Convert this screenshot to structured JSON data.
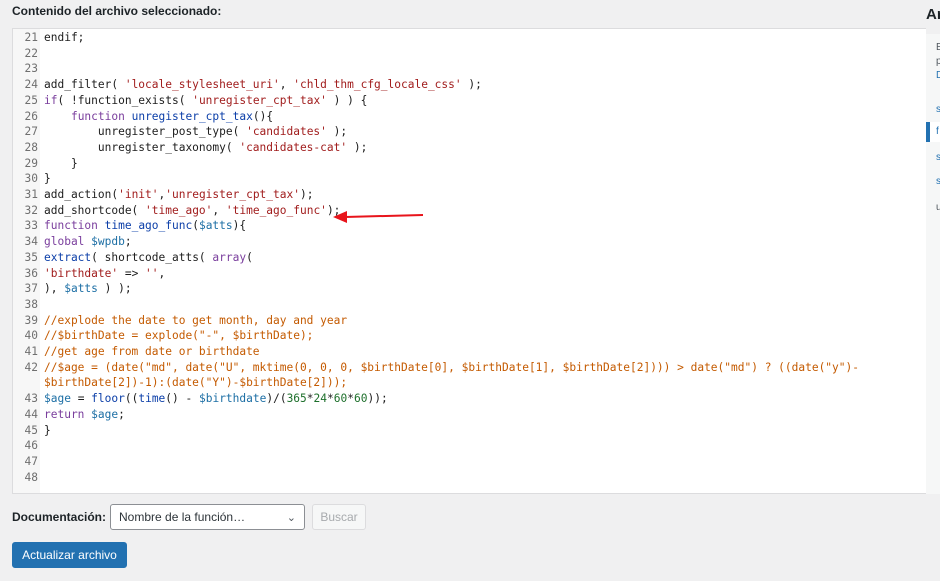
{
  "heading": "Contenido del archivo seleccionado:",
  "side_title": "Ar",
  "side_stubs": [
    "E",
    "p",
    "D",
    "s",
    "f",
    "s",
    "s",
    "u"
  ],
  "editor_lines": [
    {
      "n": "21",
      "segs": [
        [
          "endif;",
          ""
        ]
      ]
    },
    {
      "n": "22",
      "segs": []
    },
    {
      "n": "23",
      "segs": []
    },
    {
      "n": "24",
      "segs": [
        [
          "add_filter( ",
          ""
        ],
        [
          "'locale_stylesheet_uri'",
          "str"
        ],
        [
          ", ",
          ""
        ],
        [
          "'chld_thm_cfg_locale_css'",
          "str"
        ],
        [
          " );",
          ""
        ]
      ]
    },
    {
      "n": "25",
      "segs": [
        [
          "if",
          "kw"
        ],
        [
          "( !function_exists( ",
          ""
        ],
        [
          "'unregister_cpt_tax'",
          "str"
        ],
        [
          " ) ) {",
          ""
        ]
      ]
    },
    {
      "n": "26",
      "segs": [
        [
          "    ",
          ""
        ],
        [
          "function",
          "kw"
        ],
        [
          " ",
          ""
        ],
        [
          "unregister_cpt_tax",
          "fn"
        ],
        [
          "(){",
          ""
        ]
      ]
    },
    {
      "n": "27",
      "segs": [
        [
          "        unregister_post_type( ",
          ""
        ],
        [
          "'candidates'",
          "str"
        ],
        [
          " );",
          ""
        ]
      ]
    },
    {
      "n": "28",
      "segs": [
        [
          "        unregister_taxonomy( ",
          ""
        ],
        [
          "'candidates-cat'",
          "str"
        ],
        [
          " );",
          ""
        ]
      ]
    },
    {
      "n": "29",
      "segs": [
        [
          "    }",
          ""
        ]
      ]
    },
    {
      "n": "30",
      "segs": [
        [
          "}",
          ""
        ]
      ]
    },
    {
      "n": "31",
      "segs": [
        [
          "add_action(",
          ""
        ],
        [
          "'init'",
          "str"
        ],
        [
          ",",
          ""
        ],
        [
          "'unregister_cpt_tax'",
          "str"
        ],
        [
          ");",
          ""
        ]
      ]
    },
    {
      "n": "32",
      "segs": [
        [
          "add_shortcode( ",
          ""
        ],
        [
          "'time_ago'",
          "str"
        ],
        [
          ", ",
          ""
        ],
        [
          "'time_ago_func'",
          "str"
        ],
        [
          ");",
          ""
        ]
      ]
    },
    {
      "n": "33",
      "segs": [
        [
          "function",
          "kw"
        ],
        [
          " ",
          ""
        ],
        [
          "time_ago_func",
          "fn"
        ],
        [
          "(",
          ""
        ],
        [
          "$atts",
          "var"
        ],
        [
          "){",
          ""
        ]
      ]
    },
    {
      "n": "34",
      "segs": [
        [
          "global",
          "kw"
        ],
        [
          " ",
          ""
        ],
        [
          "$wpdb",
          "var"
        ],
        [
          ";",
          ""
        ]
      ]
    },
    {
      "n": "35",
      "segs": [
        [
          "extract",
          "fn"
        ],
        [
          "( shortcode_atts( ",
          ""
        ],
        [
          "array",
          "kw"
        ],
        [
          "(",
          ""
        ]
      ]
    },
    {
      "n": "36",
      "segs": [
        [
          "'birthdate'",
          "str"
        ],
        [
          " => ",
          ""
        ],
        [
          "''",
          "str"
        ],
        [
          ",",
          ""
        ]
      ]
    },
    {
      "n": "37",
      "segs": [
        [
          "), ",
          ""
        ],
        [
          "$atts",
          "var"
        ],
        [
          " ) );",
          ""
        ]
      ]
    },
    {
      "n": "38",
      "segs": []
    },
    {
      "n": "39",
      "segs": [
        [
          "//explode the date to get month, day and year",
          "comment"
        ]
      ]
    },
    {
      "n": "40",
      "segs": [
        [
          "//$birthDate = explode(\"-\", $birthDate);",
          "comment"
        ]
      ]
    },
    {
      "n": "41",
      "segs": [
        [
          "//get age from date or birthdate",
          "comment"
        ]
      ]
    },
    {
      "n": "42",
      "segs": [
        [
          "//$age = (date(\"md\", date(\"U\", mktime(0, 0, 0, $birthDate[0], $birthDate[1], $birthDate[2]))) > date(\"md\") ? ((date(\"y\")-",
          "comment"
        ]
      ]
    },
    {
      "n": "",
      "segs": [
        [
          "$birthDate[2])-1):(date(\"Y\")-$birthDate[2]));",
          "comment"
        ]
      ]
    },
    {
      "n": "43",
      "segs": [
        [
          "$age",
          "var"
        ],
        [
          " = ",
          ""
        ],
        [
          "floor",
          "fn"
        ],
        [
          "((",
          ""
        ],
        [
          "time",
          "fn"
        ],
        [
          "() - ",
          ""
        ],
        [
          "$birthdate",
          "var"
        ],
        [
          ")/(",
          ""
        ],
        [
          "365",
          "num"
        ],
        [
          "*",
          ""
        ],
        [
          "24",
          "num"
        ],
        [
          "*",
          ""
        ],
        [
          "60",
          "num"
        ],
        [
          "*",
          ""
        ],
        [
          "60",
          "num"
        ],
        [
          "));",
          ""
        ]
      ]
    },
    {
      "n": "44",
      "segs": [
        [
          "return",
          "kw"
        ],
        [
          " ",
          ""
        ],
        [
          "$age",
          "var"
        ],
        [
          ";",
          ""
        ]
      ]
    },
    {
      "n": "45",
      "segs": [
        [
          "}",
          ""
        ]
      ]
    },
    {
      "n": "46",
      "segs": []
    },
    {
      "n": "47",
      "segs": []
    },
    {
      "n": "48",
      "segs": []
    }
  ],
  "doc": {
    "label": "Documentación:",
    "select_value": "Nombre de la función…",
    "search_label": "Buscar"
  },
  "update_label": "Actualizar archivo",
  "colors": {
    "accent": "#2271b1",
    "arrow": "#e8141b"
  }
}
